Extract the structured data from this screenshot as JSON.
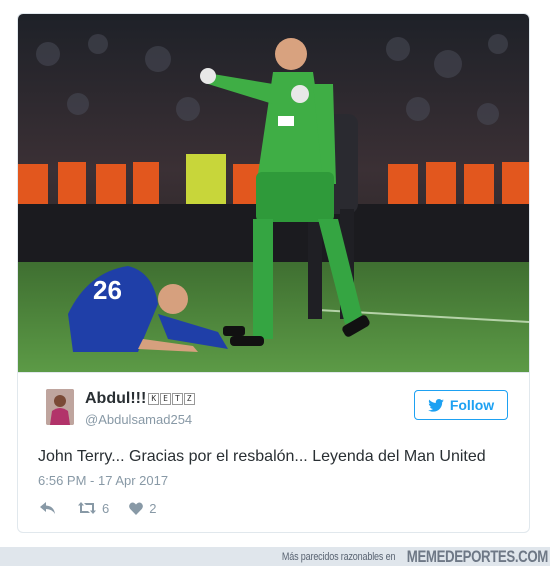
{
  "tweet": {
    "photo_desc": "football-match-photo",
    "author": {
      "display_name": "Abdul!!!",
      "name_badges": [
        "K",
        "E",
        "T",
        "Z"
      ],
      "handle": "@Abdulsamad254"
    },
    "follow_label": "Follow",
    "text": "John Terry... Gracias por el resbalón... Leyenda del Man United",
    "timestamp": "6:56 PM - 17 Apr 2017",
    "actions": {
      "reply_icon": "reply-icon",
      "retweet_icon": "retweet-icon",
      "retweet_count": "6",
      "like_icon": "heart-icon",
      "like_count": "2"
    }
  },
  "footer": {
    "tagline": "Más parecidos razonables en",
    "brand": "MEMEDEPORTES.COM"
  },
  "colors": {
    "twitter_blue": "#1da1f2",
    "muted": "#8899a6",
    "text": "#292f33",
    "kit_green": "#3fae45",
    "kit_blue": "#1f3fa8",
    "pitch": "#4f8a3a"
  }
}
